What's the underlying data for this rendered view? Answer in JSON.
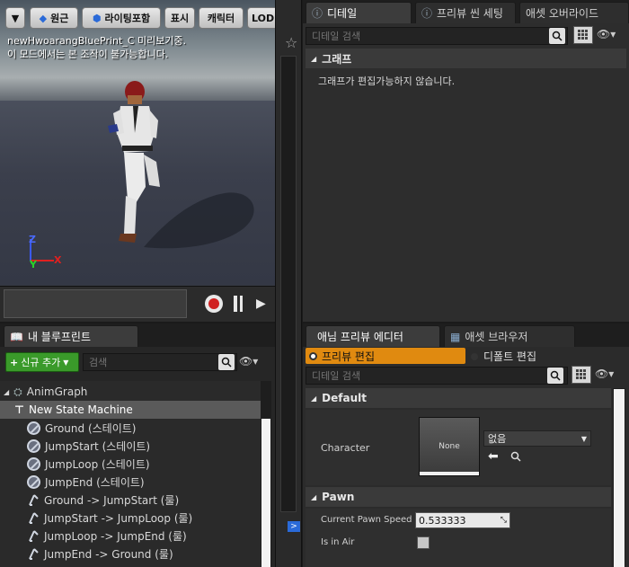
{
  "viewport": {
    "toolbar": {
      "dropdown_label": "",
      "perspective_label": "원근",
      "lighting_label": "라이팅포함",
      "show_label": "표시",
      "character_label": "캐릭터",
      "lod_label": "LOD"
    },
    "message_line1": "newHwoarangBluePrint_C 미리보기중.",
    "message_line2": "이 모드에서는 본 조작이 불가능합니다.",
    "axis": {
      "z": "Z",
      "y": "Y",
      "x": "X"
    }
  },
  "details_tabs": [
    {
      "label": "디테일"
    },
    {
      "label": "프리뷰 씬 세팅"
    },
    {
      "label": "애셋 오버라이드"
    }
  ],
  "details": {
    "search_placeholder": "디테일 검색",
    "section_title": "그래프",
    "message": "그래프가 편집가능하지 않습니다."
  },
  "blueprint_panel": {
    "tab_label": "내 블루프린트",
    "add_new_label": "신규 추가",
    "search_placeholder": "검색",
    "tree": {
      "root": "AnimGraph",
      "state_machine": "New State Machine",
      "items": [
        {
          "label": "Ground (스테이트)",
          "icon": "state-icon"
        },
        {
          "label": "JumpStart (스테이트)",
          "icon": "state-icon"
        },
        {
          "label": "JumpLoop (스테이트)",
          "icon": "state-icon"
        },
        {
          "label": "JumpEnd (스테이트)",
          "icon": "state-icon"
        },
        {
          "label": "Ground -> JumpStart (룰)",
          "icon": "transition-rule-icon"
        },
        {
          "label": "JumpStart -> JumpLoop (룰)",
          "icon": "transition-rule-icon"
        },
        {
          "label": "JumpLoop -> JumpEnd (룰)",
          "icon": "transition-rule-icon"
        },
        {
          "label": "JumpEnd -> Ground (룰)",
          "icon": "transition-rule-icon"
        }
      ]
    }
  },
  "preview_tabs": [
    {
      "label": "애님 프리뷰 에디터"
    },
    {
      "label": "애셋 브라우저"
    }
  ],
  "preview_editor": {
    "mode_preview_label": "프리뷰 편집",
    "mode_default_label": "디폴트 편집",
    "search_placeholder": "디테일 검색",
    "section_default": "Default",
    "character_label": "Character",
    "thumbnail_text": "None",
    "character_value": "없음",
    "section_pawn": "Pawn",
    "pawn_speed_label": "Current Pawn Speed",
    "pawn_speed_value": "0.533333",
    "in_air_label": "Is in Air",
    "in_air_checked": false
  },
  "colors": {
    "accent_orange": "#e08a10",
    "add_button_green": "#3a9a2a",
    "record_red": "#d02020"
  }
}
